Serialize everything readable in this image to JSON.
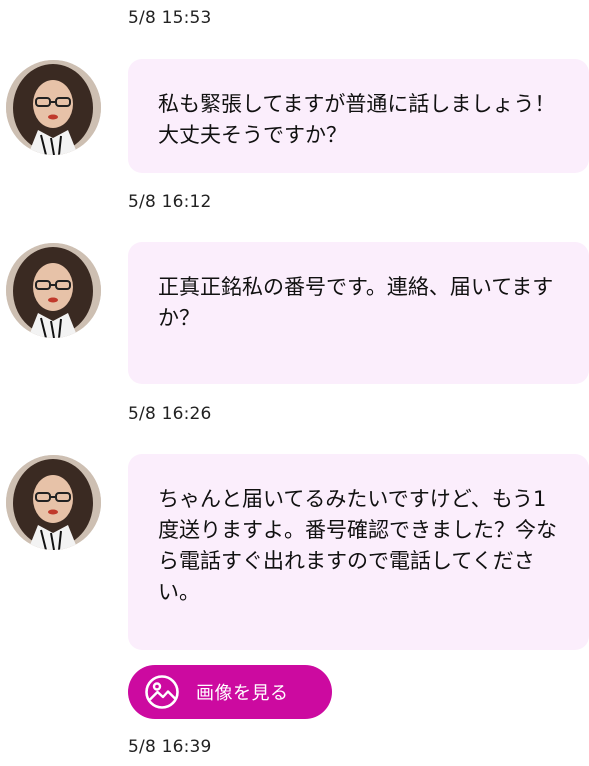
{
  "messages": [
    {
      "timestamp": "5/8 15:53",
      "text": "私も緊張してますが普通に話しましょう！大丈夫そうですか？"
    },
    {
      "timestamp": "5/8 16:12",
      "text": "正真正銘私の番号です。連絡、届いてますか？"
    },
    {
      "timestamp": "5/8 16:26",
      "text": "ちゃんと届いてるみたいですけど、もう1度送りますよ。番号確認できました？今なら電話すぐ出れますので電話してください。"
    }
  ],
  "view_image_button": {
    "label": "画像を見る",
    "icon": "image-icon"
  },
  "last_timestamp": "5/8 16:39",
  "colors": {
    "bubble": "#fbeefc",
    "button": "#cc0aa0",
    "button_text": "#ffffff"
  }
}
